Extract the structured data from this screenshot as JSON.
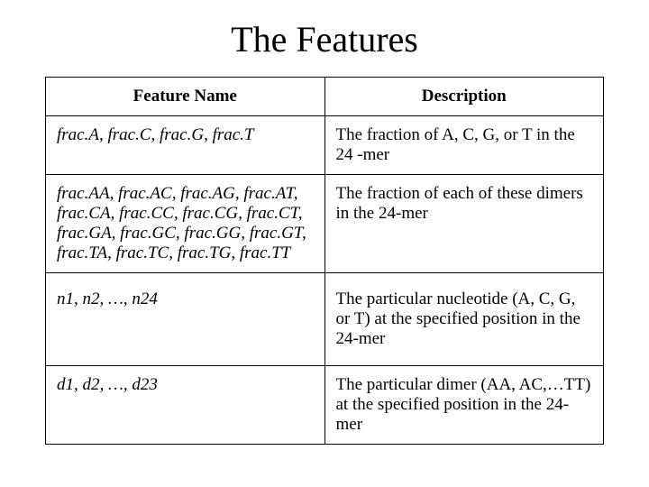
{
  "title": "The Features",
  "headers": {
    "feature": "Feature Name",
    "description": "Description"
  },
  "rows": [
    {
      "feature": "frac.A, frac.C, frac.G, frac.T",
      "description": "The fraction of A, C, G, or T in the 24 -mer"
    },
    {
      "feature": "frac.AA, frac.AC, frac.AG, frac.AT, frac.CA, frac.CC, frac.CG, frac.CT, frac.GA, frac.GC, frac.GG, frac.GT, frac.TA, frac.TC, frac.TG, frac.TT",
      "description": "The fraction of each of these dimers in the 24-mer"
    },
    {
      "feature": "n1, n2, …, n24",
      "description": "The particular nucleotide (A, C, G, or T) at the specified position in the 24-mer"
    },
    {
      "feature": "d1, d2, …, d23",
      "description": "The particular dimer (AA, AC,…TT) at the specified position in the 24-mer"
    }
  ]
}
